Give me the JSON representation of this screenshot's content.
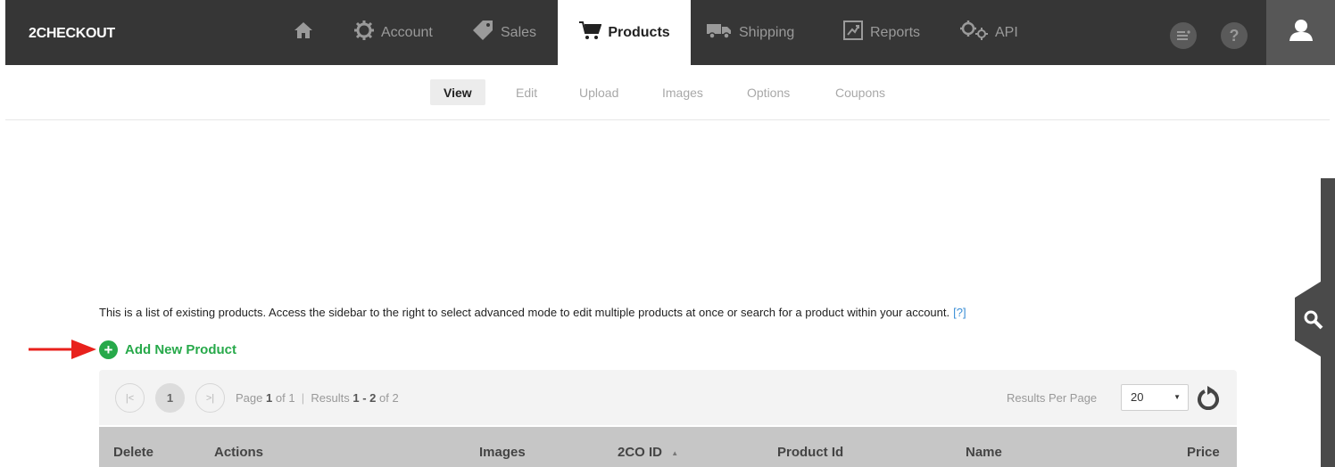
{
  "brand": {
    "logo": "2CHECKOUT"
  },
  "nav": {
    "items": [
      {
        "label": "",
        "icon": "home-icon"
      },
      {
        "label": "Account",
        "icon": "gear-icon"
      },
      {
        "label": "Sales",
        "icon": "tag-icon"
      },
      {
        "label": "Products",
        "icon": "cart-icon",
        "active": true
      },
      {
        "label": "Shipping",
        "icon": "truck-icon"
      },
      {
        "label": "Reports",
        "icon": "chart-icon"
      },
      {
        "label": "API",
        "icon": "gears-icon"
      }
    ],
    "notes_icon": "notes-icon",
    "help_label": "?",
    "user_icon": "user-icon"
  },
  "subnav": {
    "items": [
      {
        "label": "View",
        "active": true
      },
      {
        "label": "Edit"
      },
      {
        "label": "Upload"
      },
      {
        "label": "Images"
      },
      {
        "label": "Options"
      },
      {
        "label": "Coupons"
      }
    ]
  },
  "main": {
    "intro": "This is a list of existing products. Access the sidebar to the right to select advanced mode to edit multiple products at once or search for a product within your account.",
    "help_link": "[?]",
    "add_product": "Add New Product"
  },
  "pager": {
    "first": "|<",
    "current": "1",
    "last": ">|",
    "page_prefix": "Page",
    "page_num": "1",
    "page_of": "of 1",
    "separator": "|",
    "results_prefix": "Results",
    "results_range": "1 - 2",
    "results_of": "of 2",
    "per_page_label": "Results Per Page",
    "per_page_value": "20"
  },
  "table": {
    "columns": [
      "Delete",
      "Actions",
      "Images",
      "2CO ID",
      "Product Id",
      "Name",
      "Price"
    ],
    "sort_indicator": "▲"
  },
  "colors": {
    "topbar": "#363636",
    "accent_green": "#27a94a",
    "link_blue": "#3b8fd6"
  }
}
